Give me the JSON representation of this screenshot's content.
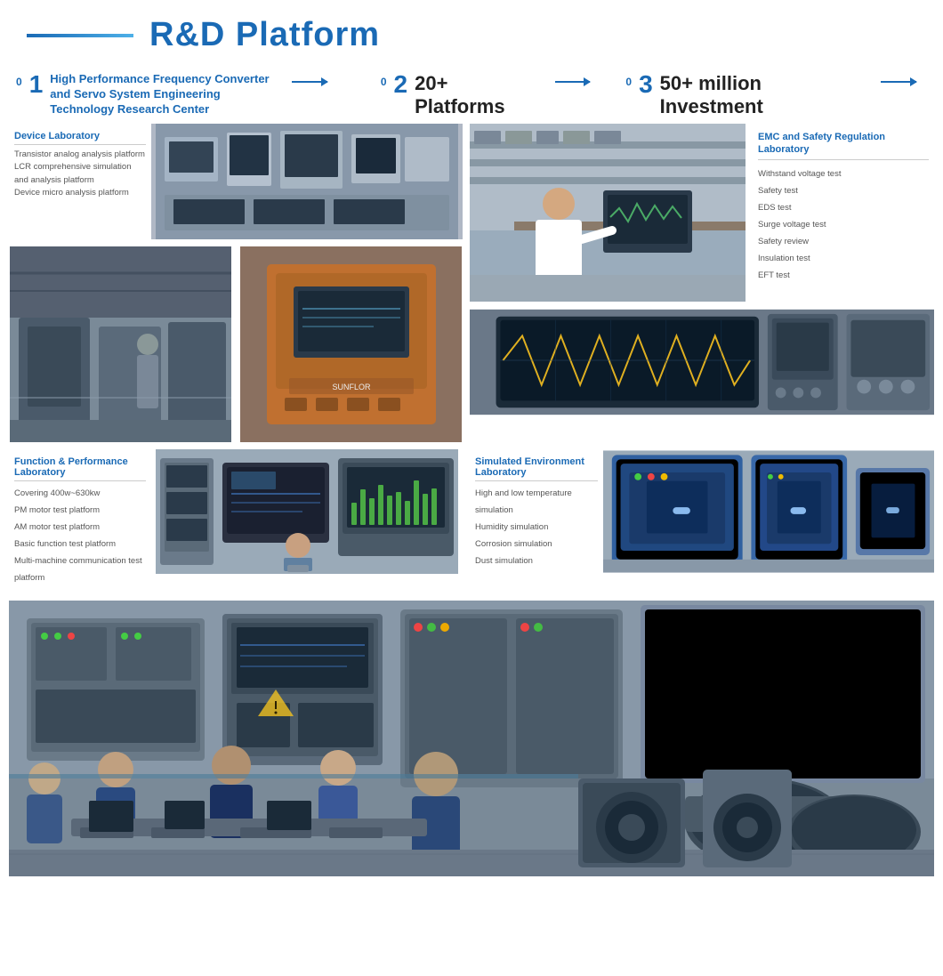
{
  "header": {
    "title": "R&D Platform"
  },
  "sections": {
    "s01": {
      "num": "01",
      "text": "High Performance Frequency Converter and Servo System Engineering Technology Research Center"
    },
    "s02": {
      "num": "02",
      "text": "20+ Platforms"
    },
    "s03": {
      "num": "03",
      "text": "50+ million Investment"
    }
  },
  "device_lab": {
    "title": "Device Laboratory",
    "items": [
      "Transistor analog analysis platform",
      "LCR comprehensive simulation and analysis platform",
      "Device micro analysis platform"
    ]
  },
  "emc_lab": {
    "title": "EMC and Safety Regulation Laboratory",
    "items": [
      "Withstand voltage test",
      "Safety test",
      "EDS test",
      "Surge voltage test",
      "Safety review",
      "Insulation test",
      "EFT test"
    ]
  },
  "func_lab": {
    "title": "Function & Performance Laboratory",
    "items": [
      "Covering 400w~630kw",
      "PM motor test platform",
      "AM motor test platform",
      "Basic function test platform",
      "Multi-machine communication test platform"
    ]
  },
  "sim_lab": {
    "title": "Simulated Environment Laboratory",
    "items": [
      "High and low temperature simulation",
      "Humidity simulation",
      "Corrosion simulation",
      "Dust simulation"
    ]
  }
}
